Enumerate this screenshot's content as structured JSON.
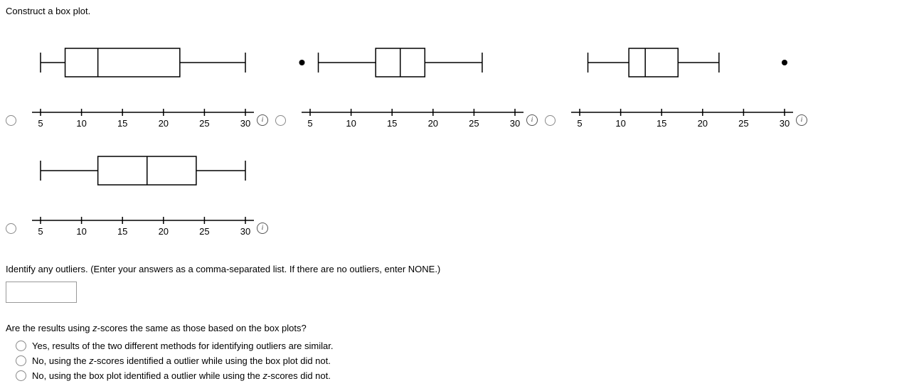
{
  "title": "Construct a box plot.",
  "axis_ticks": [
    5,
    10,
    15,
    20,
    25,
    30
  ],
  "boxplots": [
    {
      "min": 5,
      "q1": 8,
      "med": 12,
      "q3": 22,
      "max": 30,
      "outlier": null
    },
    {
      "min": 6,
      "q1": 13,
      "med": 16,
      "q3": 19,
      "max": 26,
      "outlier": {
        "side": "left",
        "x": 4
      }
    },
    {
      "min": 6,
      "q1": 11,
      "med": 13,
      "q3": 17,
      "max": 22,
      "outlier": {
        "side": "right",
        "x": 30
      }
    },
    {
      "min": 5,
      "q1": 12,
      "med": 18,
      "q3": 24,
      "max": 30,
      "outlier": null
    }
  ],
  "outliers_prompt": "Identify any outliers. (Enter your answers as a comma-separated list. If there are no outliers, enter NONE.)",
  "zscore_prompt_prefix": "Are the results using ",
  "zscore_prompt_suffix": "-scores the same as those based on the box plots?",
  "z_letter": "z",
  "choices": [
    {
      "pre": "Yes, results of the two different methods for identifying outliers are similar.",
      "z": false
    },
    {
      "pre": "No, using the ",
      "mid": "-scores identified a outlier while using the box plot did not.",
      "z": true
    },
    {
      "pre": "No, using the box plot identified a outlier while using the ",
      "mid": "-scores did not.",
      "z": true
    }
  ],
  "chart_data": [
    {
      "type": "boxplot",
      "ticks": [
        5,
        10,
        15,
        20,
        25,
        30
      ],
      "min": 5,
      "q1": 8,
      "median": 12,
      "q3": 22,
      "max": 30,
      "outliers": []
    },
    {
      "type": "boxplot",
      "ticks": [
        5,
        10,
        15,
        20,
        25,
        30
      ],
      "min": 6,
      "q1": 13,
      "median": 16,
      "q3": 19,
      "max": 26,
      "outliers": [
        4
      ]
    },
    {
      "type": "boxplot",
      "ticks": [
        5,
        10,
        15,
        20,
        25,
        30
      ],
      "min": 6,
      "q1": 11,
      "median": 13,
      "q3": 17,
      "max": 22,
      "outliers": [
        30
      ]
    },
    {
      "type": "boxplot",
      "ticks": [
        5,
        10,
        15,
        20,
        25,
        30
      ],
      "min": 5,
      "q1": 12,
      "median": 18,
      "q3": 24,
      "max": 30,
      "outliers": []
    }
  ]
}
